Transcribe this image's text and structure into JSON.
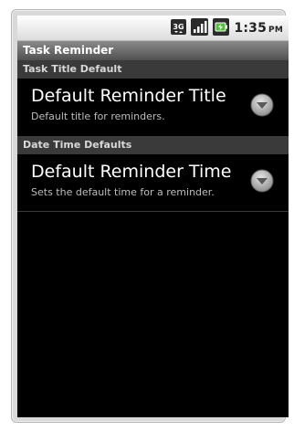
{
  "status_bar": {
    "network_icon": "3g-icon",
    "signal_icon": "signal-icon",
    "battery_icon": "battery-charging-icon",
    "time": "1:35",
    "ampm": "PM"
  },
  "app": {
    "title": "Task Reminder"
  },
  "sections": [
    {
      "header": "Task Title Default",
      "item": {
        "title": "Default Reminder Title",
        "summary": "Default title for reminders."
      }
    },
    {
      "header": "Date Time Defaults",
      "item": {
        "title": "Default Reminder Time",
        "summary": "Sets the default time for a reminder."
      }
    }
  ],
  "colors": {
    "background": "#000000",
    "category": "#3a3a3a",
    "title_bar": "#5e5e5e",
    "text_primary": "#ffffff",
    "text_secondary": "#bdbdbd"
  }
}
